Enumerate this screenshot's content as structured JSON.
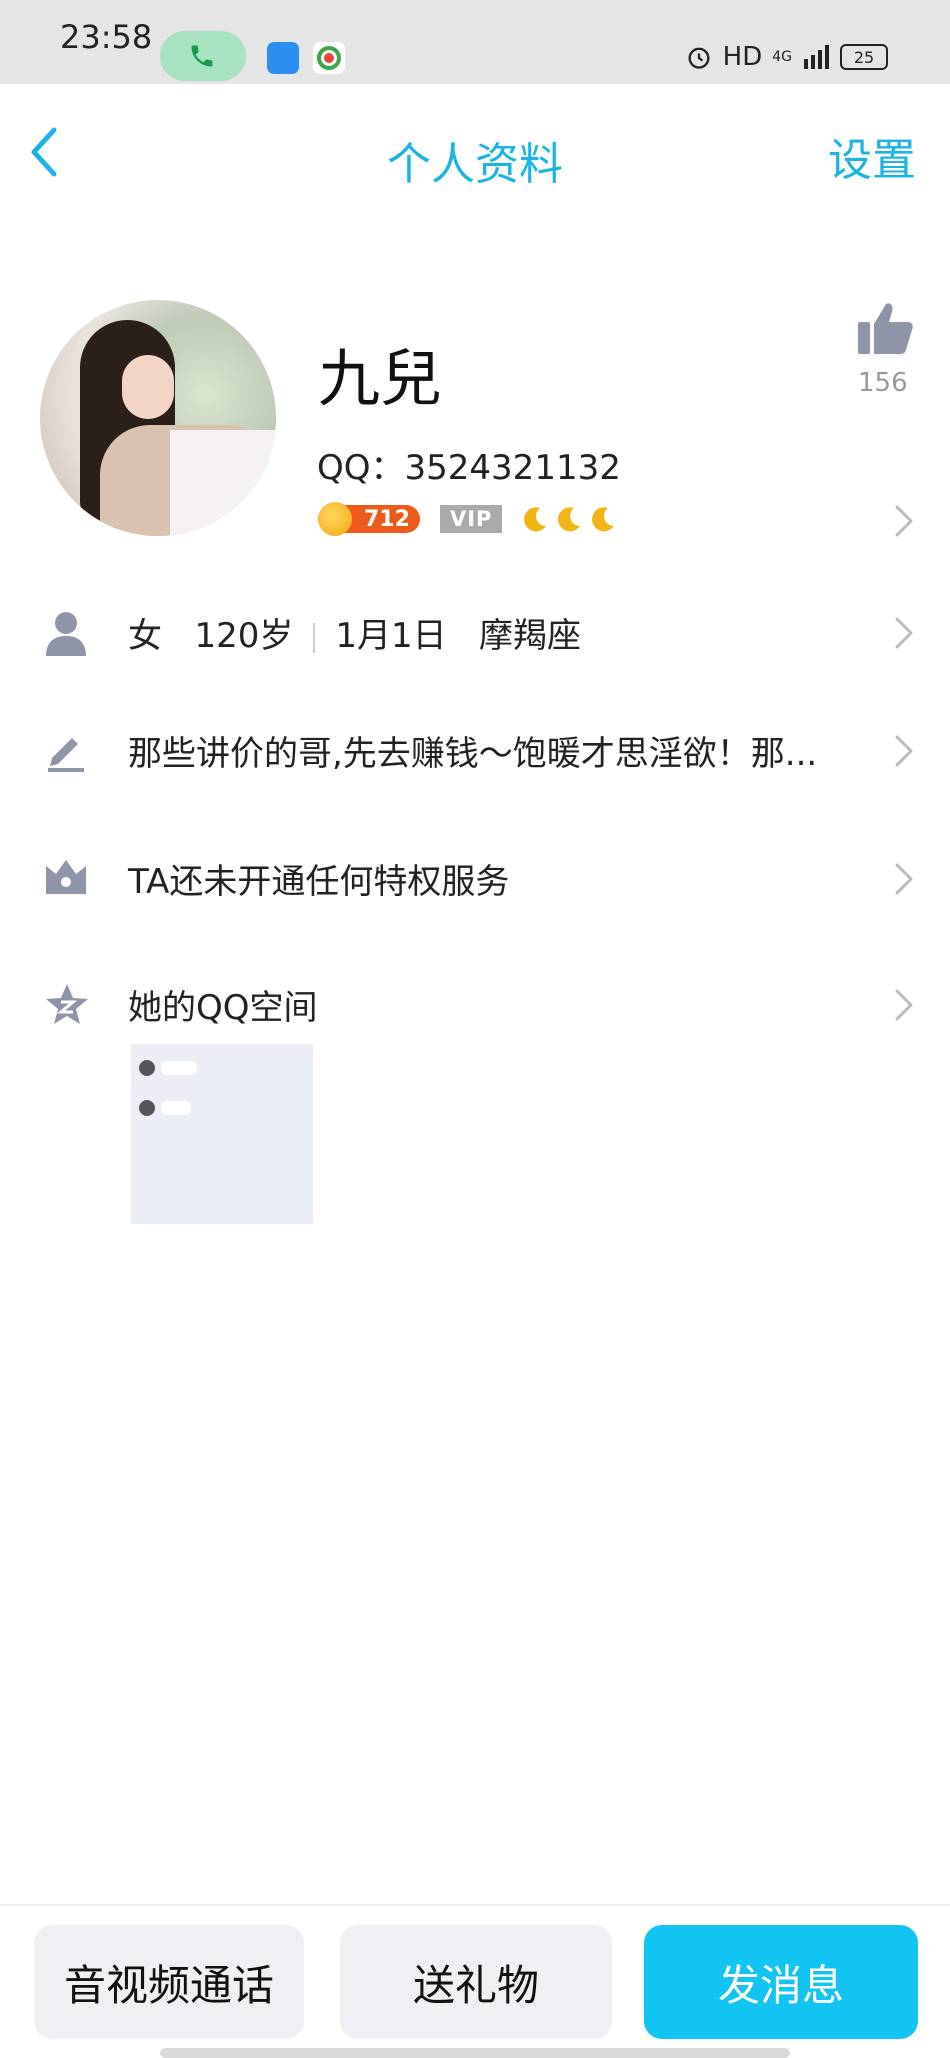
{
  "status_bar": {
    "time": "23:58",
    "network": "HD",
    "signal_label": "4G",
    "battery": "25"
  },
  "nav": {
    "title": "个人资料",
    "settings": "设置"
  },
  "profile": {
    "name": "九兒",
    "qq": "QQ：3524321132",
    "level": "712",
    "vip": "VIP",
    "likes": "156"
  },
  "rows": {
    "gender": "女",
    "age": "120岁",
    "birthday": "1月1日",
    "zodiac": "摩羯座",
    "signature": "那些讲价的哥,先去赚钱～饱暖才思淫欲！那...",
    "privilege": "TA还未开通任何特权服务",
    "qzone": "她的QQ空间"
  },
  "actions": {
    "call": "音视频通话",
    "gift": "送礼物",
    "message": "发消息"
  },
  "colors": {
    "accent": "#1cb4e4",
    "primary_button": "#12c4f2",
    "level_badge": "#ec5b1c"
  }
}
